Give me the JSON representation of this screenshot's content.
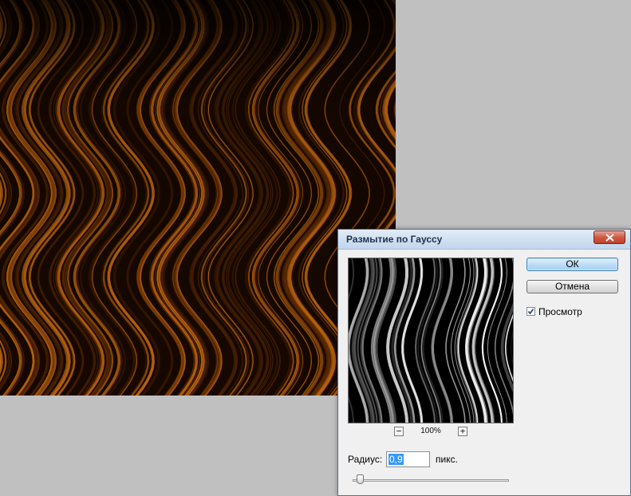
{
  "dialog": {
    "title": "Размытие по Гауссу",
    "ok_label": "ОК",
    "cancel_label": "Отмена",
    "preview_label": "Просмотр",
    "preview_checked": true,
    "zoom_level": "100%",
    "zoom_out_label": "−",
    "zoom_in_label": "+",
    "radius_label": "Радиус:",
    "radius_value": "0,9",
    "radius_unit": "пикс."
  },
  "colors": {
    "hair_highlight": "#d07010",
    "hair_dark": "#160800",
    "workspace_bg": "#c0c0c0"
  },
  "icons": {
    "close": "close-icon",
    "check": "checkmark-icon"
  }
}
